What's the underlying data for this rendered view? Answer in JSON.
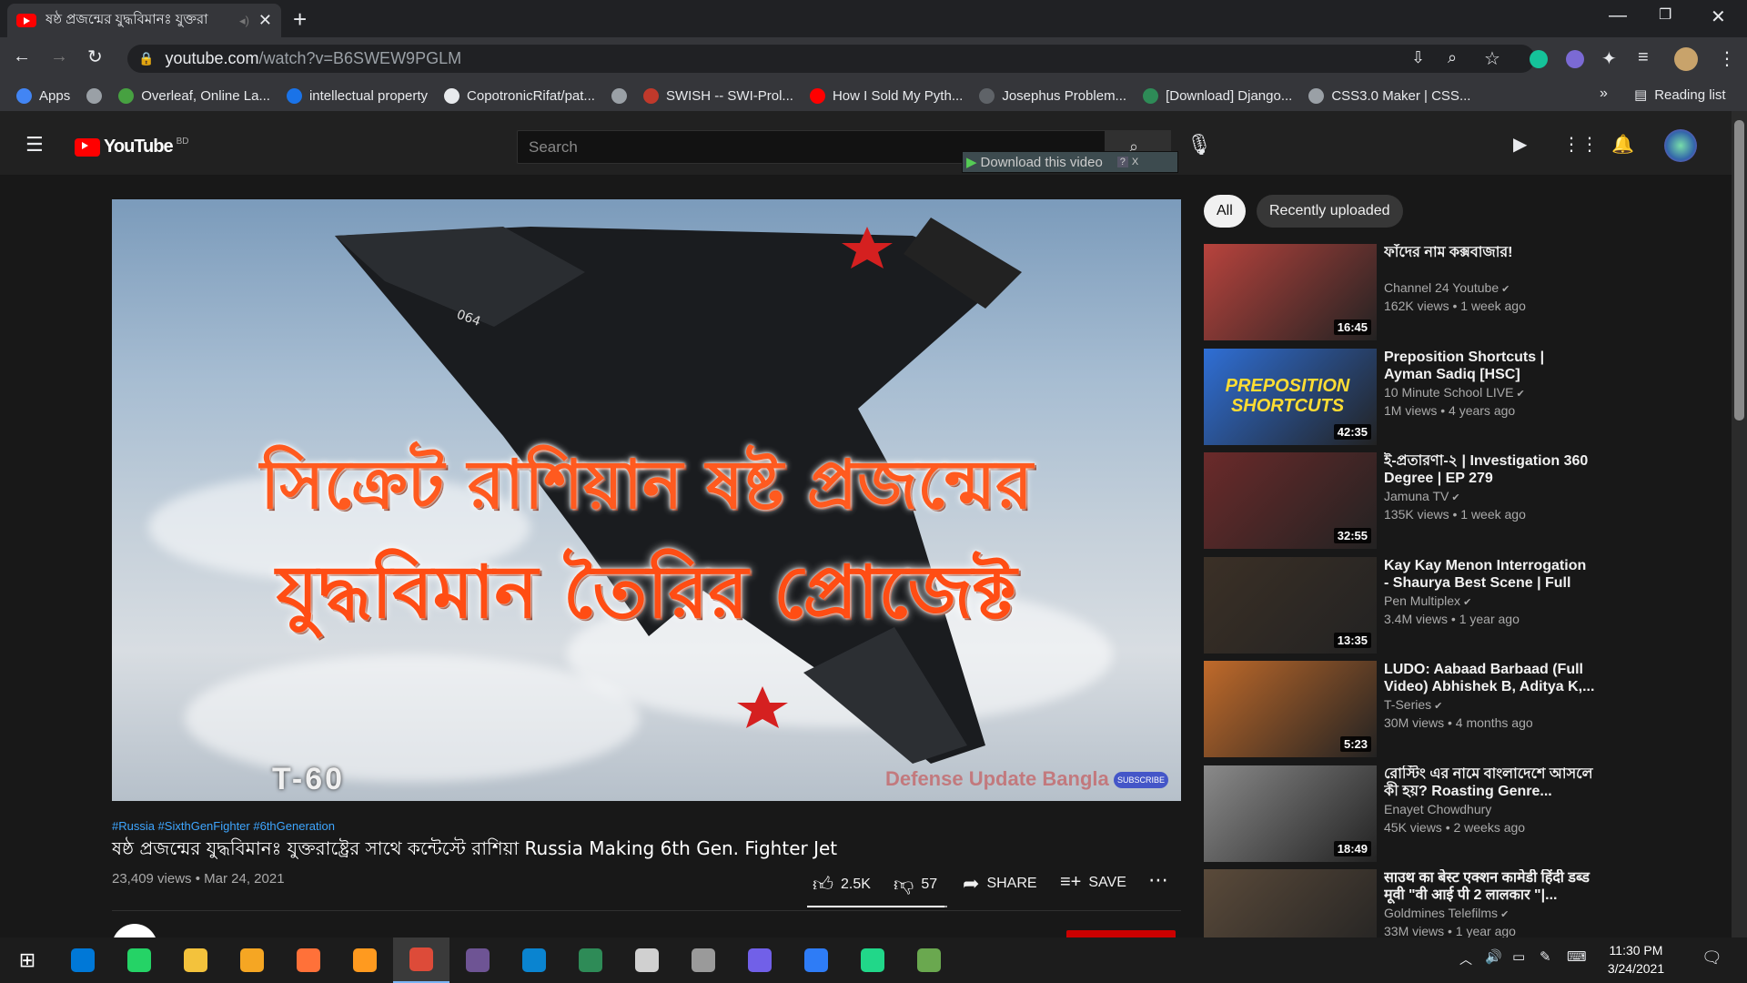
{
  "browser": {
    "tab_title": "ষষ্ঠ প্রজন্মের যুদ্ধবিমানঃ যুক্তরা",
    "url_host": "youtube.com",
    "url_path": "/watch?v=B6SWEW9PGLM",
    "bookmarks": [
      {
        "label": "Apps",
        "color": "#4285f4"
      },
      {
        "label": "",
        "color": "#9aa0a6"
      },
      {
        "label": "Overleaf, Online La...",
        "color": "#47a141"
      },
      {
        "label": "intellectual property",
        "color": "#1a73e8"
      },
      {
        "label": "CopotronicRifat/pat...",
        "color": "#e8eaed"
      },
      {
        "label": "",
        "color": "#9aa0a6"
      },
      {
        "label": "SWISH -- SWI-Prol...",
        "color": "#c0392b"
      },
      {
        "label": "How I Sold My Pyth...",
        "color": "#ff0000"
      },
      {
        "label": "Josephus Problem...",
        "color": "#5f6368"
      },
      {
        "label": "[Download] Django...",
        "color": "#2e8b57"
      },
      {
        "label": "CSS3.0 Maker | CSS...",
        "color": "#9aa0a6"
      }
    ],
    "reading_list": "Reading list",
    "more": "»"
  },
  "youtube": {
    "logo_text": "YouTube",
    "region": "BD",
    "search_placeholder": "Search",
    "download_label": "Download this video",
    "download_help": "?",
    "download_close": "X"
  },
  "video": {
    "thumb_line1": "সিক্রেট রাশিয়ান ষষ্ট প্রজন্মের",
    "thumb_line2": "যুদ্ধবিমান তৈরির প্রোজেক্ট",
    "thumb_model": "T-60",
    "thumb_watermark": "Defense Update Bangla",
    "thumb_subscribe": "SUBSCRIBE",
    "hashtags": "#Russia #SixthGenFighter #6thGeneration",
    "title": "ষষ্ঠ প্রজন্মের যুদ্ধবিমানঃ যুক্তরাষ্ট্রের সাথে কন্টেস্টে রাশিয়া Russia Making 6th Gen. Fighter Jet",
    "views": "23,409 views",
    "date": "Mar 24, 2021",
    "likes": "2.5K",
    "dislikes": "57",
    "share": "SHARE",
    "save": "SAVE",
    "like_ratio": 0.978
  },
  "sidebar": {
    "chips": [
      "All",
      "Recently uploaded"
    ],
    "items": [
      {
        "title": "ফাঁদের নাম কক্সবাজার!",
        "channel": "Channel 24 Youtube",
        "meta": "162K views • 1 week ago",
        "duration": "16:45",
        "thumb_bg": "#b8433d",
        "verified": true
      },
      {
        "title": "Preposition Shortcuts | Ayman Sadiq [HSC]",
        "channel": "10 Minute School LIVE",
        "meta": "1M views • 4 years ago",
        "duration": "42:35",
        "thumb_bg": "#2f6fd6",
        "thumb_text": "PREPOSITION SHORTCUTS",
        "verified": true
      },
      {
        "title": "ই-প্রতারণা-২ | Investigation 360 Degree | EP 279",
        "channel": "Jamuna TV",
        "meta": "135K views • 1 week ago",
        "duration": "32:55",
        "thumb_bg": "#6b2a2a",
        "verified": true
      },
      {
        "title": "Kay Kay Menon Interrogation - Shaurya Best Scene | Full Hind...",
        "channel": "Pen Multiplex",
        "meta": "3.4M views • 1 year ago",
        "duration": "13:35",
        "thumb_bg": "#3b3026",
        "verified": true
      },
      {
        "title": "LUDO: Aabaad Barbaad (Full Video) Abhishek B, Aditya K,...",
        "channel": "T-Series",
        "meta": "30M views • 4 months ago",
        "duration": "5:23",
        "thumb_bg": "#c06a2a",
        "verified": true
      },
      {
        "title": "রোস্টিং এর নামে বাংলাদেশে আসলে কী হয়? Roasting Genre...",
        "channel": "Enayet Chowdhury",
        "meta": "45K views • 2 weeks ago",
        "duration": "18:49",
        "thumb_bg": "#8a8a8a",
        "verified": false
      },
      {
        "title": "साउथ का बेस्ट एक्शन कामेडी हिंदी डब्ड मूवी \"वी आई पी 2 लालकार \"|...",
        "channel": "Goldmines Telefilms",
        "meta": "33M views • 1 year ago",
        "duration": "",
        "thumb_bg": "#5a4a3a",
        "verified": true
      }
    ]
  },
  "taskbar": {
    "time": "11:30 PM",
    "date": "3/24/2021",
    "apps": [
      {
        "name": "search",
        "color": "#0078d7"
      },
      {
        "name": "whatsapp",
        "color": "#25d366"
      },
      {
        "name": "explorer",
        "color": "#f3c23c"
      },
      {
        "name": "tor",
        "color": "#f5a623"
      },
      {
        "name": "firefox",
        "color": "#ff7139"
      },
      {
        "name": "overleaf",
        "color": "#ff9a1f"
      },
      {
        "name": "chrome",
        "color": "#dd4b39"
      },
      {
        "name": "github",
        "color": "#6e5494"
      },
      {
        "name": "vscode",
        "color": "#0a84d0"
      },
      {
        "name": "app",
        "color": "#2e8b57"
      },
      {
        "name": "paint",
        "color": "#d0d0d0"
      },
      {
        "name": "inkscape",
        "color": "#9a9a9a"
      },
      {
        "name": "visual-studio",
        "color": "#7160e8"
      },
      {
        "name": "messenger",
        "color": "#2e7cf6"
      },
      {
        "name": "pycharm",
        "color": "#21d789"
      },
      {
        "name": "editor",
        "color": "#6aa84f"
      }
    ]
  }
}
